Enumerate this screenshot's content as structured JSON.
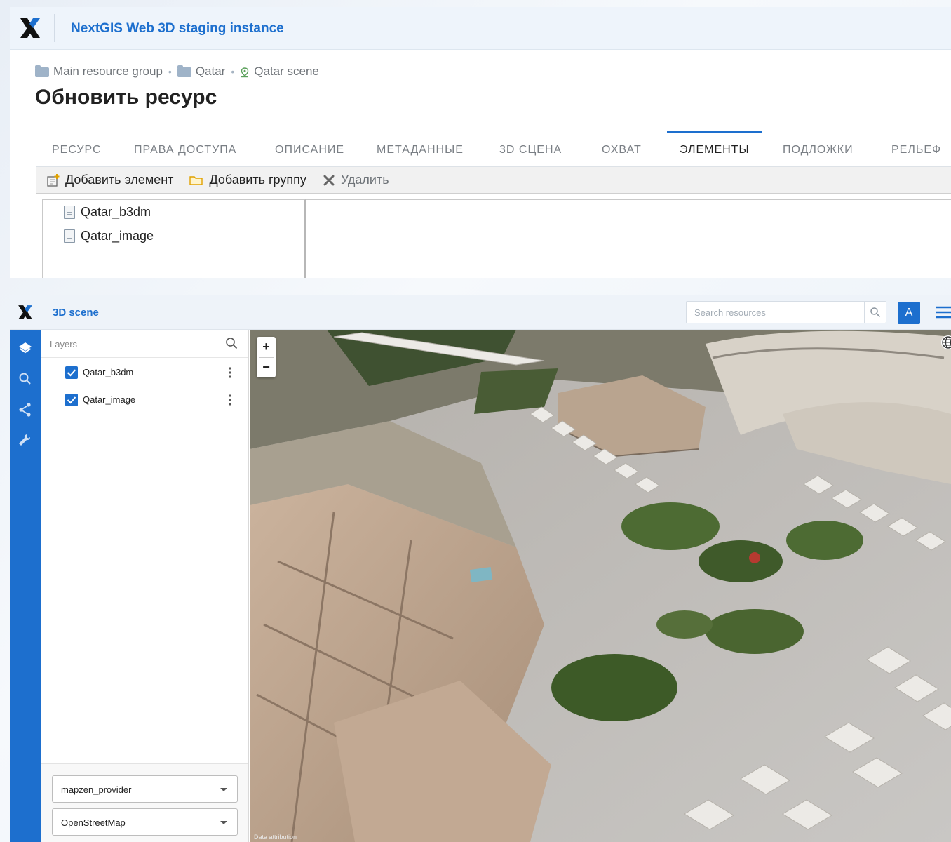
{
  "top_window": {
    "app_title": "NextGIS Web 3D staging instance",
    "breadcrumb": [
      "Main resource group",
      "Qatar",
      "Qatar scene"
    ],
    "page_title": "Обновить ресурс",
    "tabs": [
      "РЕСУРС",
      "ПРАВА ДОСТУПА",
      "ОПИСАНИЕ",
      "МЕТАДАННЫЕ",
      "3D СЦЕНА",
      "ОХВАТ",
      "ЭЛЕМЕНТЫ",
      "ПОДЛОЖКИ",
      "РЕЛЬЕФ"
    ],
    "active_tab": "ЭЛЕМЕНТЫ",
    "toolbar": {
      "add_item": "Добавить элемент",
      "add_group": "Добавить группу",
      "delete": "Удалить"
    },
    "items": [
      "Qatar_b3dm",
      "Qatar_image"
    ]
  },
  "bottom_window": {
    "title": "3D scene",
    "search_placeholder": "Search resources",
    "avatar_letter": "A",
    "layers_label": "Layers",
    "layers": [
      {
        "name": "Qatar_b3dm",
        "checked": true
      },
      {
        "name": "Qatar_image",
        "checked": true
      }
    ],
    "provider_select": "mapzen_provider",
    "basemap_select": "OpenStreetMap",
    "zoom_in": "+",
    "zoom_out": "−",
    "attribution": "Data attribution"
  },
  "colors": {
    "accent": "#1d6fce",
    "rail": "#1d6fce"
  },
  "icons": [
    "nextgis-logo",
    "folder-icon",
    "map-pin-icon",
    "add-item-icon",
    "folder-open-icon",
    "delete-icon",
    "document-icon",
    "layers-icon",
    "search-icon",
    "share-icon",
    "wrench-icon",
    "kebab-icon",
    "menu-icon",
    "globe-icon"
  ]
}
